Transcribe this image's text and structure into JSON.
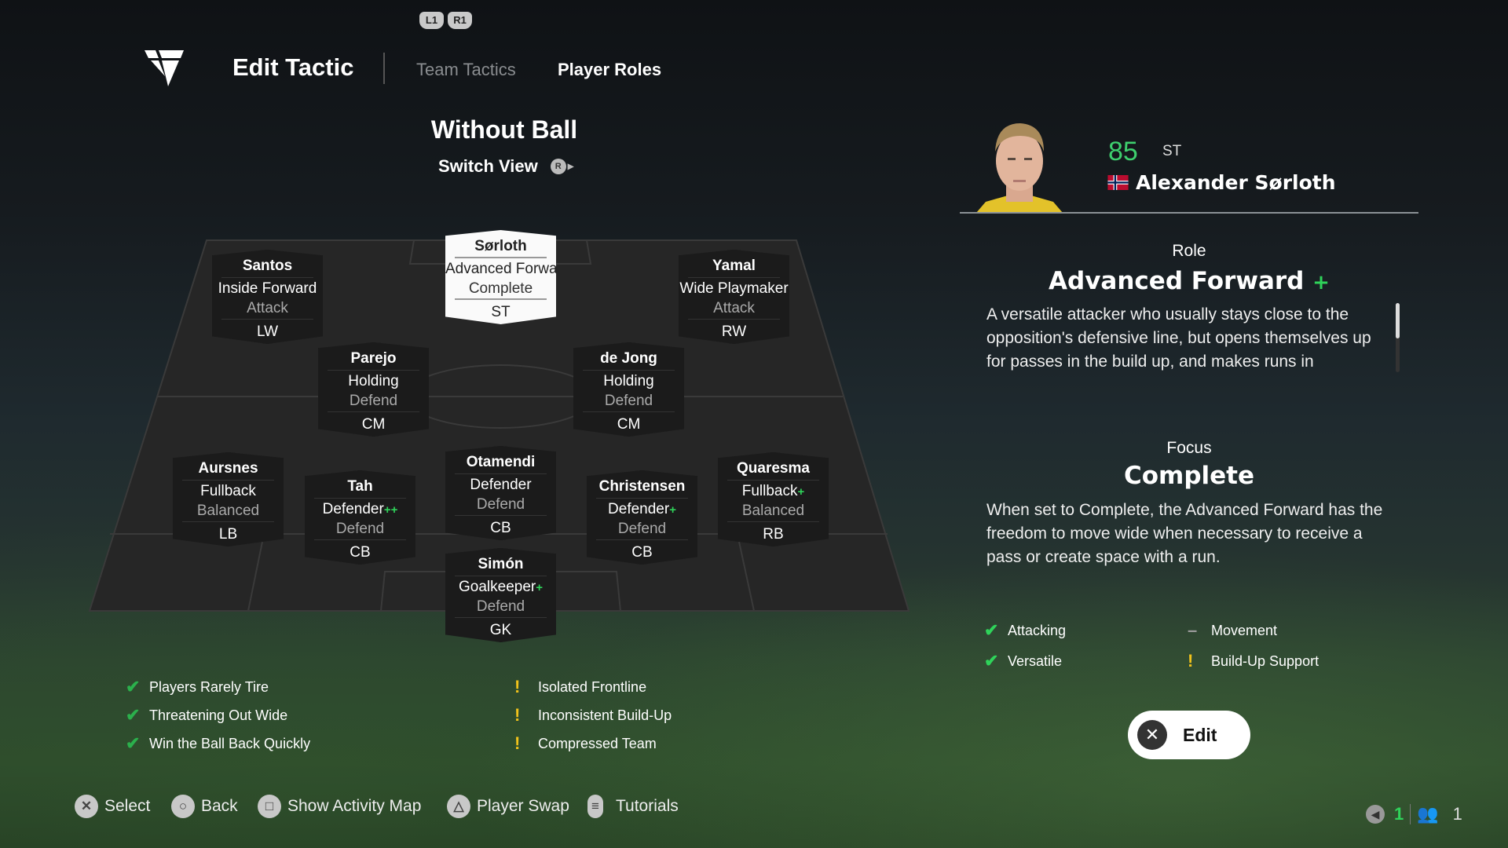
{
  "header": {
    "shoulder_left": "L1",
    "shoulder_right": "R1",
    "title": "Edit Tactic",
    "tabs": [
      {
        "label": "Team Tactics",
        "active": false
      },
      {
        "label": "Player Roles",
        "active": true
      }
    ]
  },
  "view": {
    "title": "Without Ball",
    "switch_label": "Switch View",
    "switch_button": "R"
  },
  "players": [
    {
      "name": "Sørloth",
      "role": "Advanced Forward",
      "plus": "+",
      "mentality": "Complete",
      "pos": "ST",
      "selected": true
    },
    {
      "name": "Santos",
      "role": "Inside Forward",
      "plus": "",
      "mentality": "Attack",
      "pos": "LW"
    },
    {
      "name": "Yamal",
      "role": "Wide Playmaker",
      "plus": "",
      "mentality": "Attack",
      "pos": "RW"
    },
    {
      "name": "Parejo",
      "role": "Holding",
      "plus": "",
      "mentality": "Defend",
      "pos": "CM"
    },
    {
      "name": "de Jong",
      "role": "Holding",
      "plus": "",
      "mentality": "Defend",
      "pos": "CM"
    },
    {
      "name": "Aursnes",
      "role": "Fullback",
      "plus": "",
      "mentality": "Balanced",
      "pos": "LB"
    },
    {
      "name": "Tah",
      "role": "Defender",
      "plus": "++",
      "mentality": "Defend",
      "pos": "CB"
    },
    {
      "name": "Otamendi",
      "role": "Defender",
      "plus": "",
      "mentality": "Defend",
      "pos": "CB"
    },
    {
      "name": "Christensen",
      "role": "Defender",
      "plus": "+",
      "mentality": "Defend",
      "pos": "CB"
    },
    {
      "name": "Quaresma",
      "role": "Fullback",
      "plus": "+",
      "mentality": "Balanced",
      "pos": "RB"
    },
    {
      "name": "Simón",
      "role": "Goalkeeper",
      "plus": "+",
      "mentality": "Defend",
      "pos": "GK"
    }
  ],
  "strengths": [
    "Players Rarely Tire",
    "Threatening Out Wide",
    "Win the Ball Back Quickly"
  ],
  "weaknesses": [
    "Isolated Frontline",
    "Inconsistent Build-Up",
    "Compressed Team"
  ],
  "hints": [
    {
      "icon": "cross-button-icon",
      "glyph": "✕",
      "label": "Select"
    },
    {
      "icon": "circle-button-icon",
      "glyph": "○",
      "label": "Back"
    },
    {
      "icon": "square-button-icon",
      "glyph": "□",
      "label": "Show Activity Map"
    },
    {
      "icon": "triangle-button-icon",
      "glyph": "△",
      "label": "Player Swap"
    },
    {
      "icon": "options-button-icon",
      "glyph": "≡",
      "label": "Tutorials"
    }
  ],
  "selected_player": {
    "rating": "85",
    "position": "ST",
    "name": "Alexander Sørloth",
    "nation": "Norway",
    "role_label": "Role",
    "role": "Advanced Forward",
    "role_plus": "+",
    "role_desc": "A versatile attacker who usually stays close to the opposition's defensive line, but opens themselves up for passes in the build up, and makes runs in",
    "focus_label": "Focus",
    "focus": "Complete",
    "focus_desc": "When set to Complete, the Advanced Forward has the freedom to move wide when necessary to receive a pass or create space with a run.",
    "traits": [
      {
        "icon": "check",
        "label": "Attacking"
      },
      {
        "icon": "dash",
        "label": "Movement"
      },
      {
        "icon": "check",
        "label": "Versatile"
      },
      {
        "icon": "warning",
        "label": "Build-Up Support"
      }
    ]
  },
  "edit_button": {
    "glyph": "✕",
    "label": "Edit"
  },
  "status": {
    "voice_count": "1",
    "party_count": "1"
  },
  "colors": {
    "accent_green": "#2fd35a",
    "rating_green": "#3ecf6e",
    "warning": "#f1c21b"
  }
}
